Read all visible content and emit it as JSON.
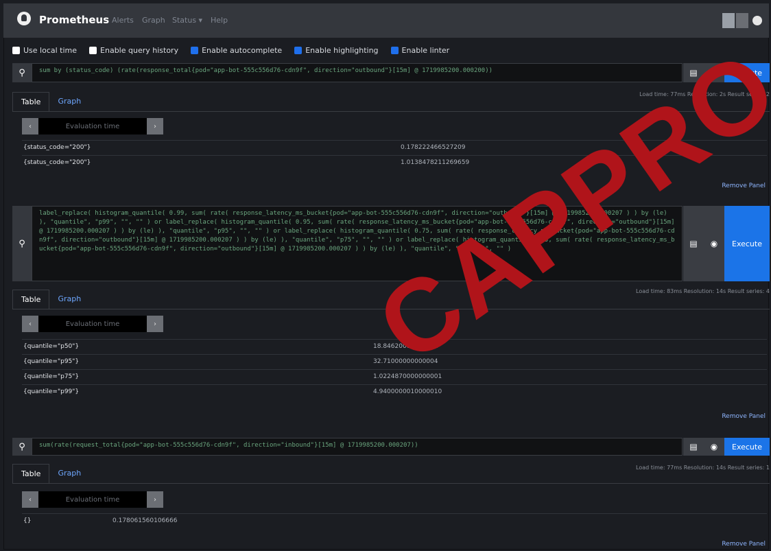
{
  "navbar": {
    "brand": "Prometheus",
    "links": [
      "Alerts",
      "Graph",
      "Status ▾",
      "Help"
    ]
  },
  "options": [
    {
      "label": "Use local time",
      "checked": false
    },
    {
      "label": "Enable query history",
      "checked": false
    },
    {
      "label": "Enable autocomplete",
      "checked": true
    },
    {
      "label": "Enable highlighting",
      "checked": true
    },
    {
      "label": "Enable linter",
      "checked": true
    }
  ],
  "execute_label": "Execute",
  "tab_table": "Table",
  "tab_graph": "Graph",
  "eval_placeholder": "Evaluation time",
  "remove_panel": "Remove Panel",
  "icons": {
    "search": "search-icon",
    "history": "history-icon",
    "metrics": "metrics-explorer-icon",
    "theme": "theme-toggle-icon"
  },
  "panels": [
    {
      "query": "sum by (status_code) (rate(response_total{pod=\"app-bot-555c556d76-cdn9f\", direction=\"outbound\"}[15m] @ 1719985200.000200))",
      "stats": "Load time: 77ms   Resolution: 2s   Result series: 2",
      "rows": [
        {
          "key": "{status_code=\"200\"}",
          "value": "0.178222466527209"
        },
        {
          "key": "{status_code=\"200\"}",
          "value": "1.0138478211269659"
        }
      ]
    },
    {
      "query": "label_replace( histogram_quantile( 0.99, sum( rate( response_latency_ms_bucket{pod=\"app-bot-555c556d76-cdn9f\", direction=\"outbound\"}[15m] @ 1719985200.000207 ) ) by (le) ), \"quantile\", \"p99\", \"\", \"\" ) or label_replace( histogram_quantile( 0.95, sum( rate( response_latency_ms_bucket{pod=\"app-bot-555c556d76-cdn9f\", direction=\"outbound\"}[15m] @ 1719985200.000207 ) ) by (le) ), \"quantile\", \"p95\", \"\", \"\" ) or label_replace( histogram_quantile( 0.75, sum( rate( response_latency_ms_bucket{pod=\"app-bot-555c556d76-cdn9f\", direction=\"outbound\"}[15m] @ 1719985200.000207 ) ) by (le) ), \"quantile\", \"p75\", \"\", \"\" ) or label_replace( histogram_quantile( 0.5, sum( rate( response_latency_ms_bucket{pod=\"app-bot-555c556d76-cdn9f\", direction=\"outbound\"}[15m] @ 1719985200.000207 ) ) by (le) ), \"quantile\", \"p50\", \"\", \"\" )",
      "stats": "Load time: 83ms   Resolution: 14s   Result series: 4",
      "rows": [
        {
          "key": "{quantile=\"p50\"}",
          "value": "18.84620000000001"
        },
        {
          "key": "{quantile=\"p95\"}",
          "value": "32.71000000000004"
        },
        {
          "key": "{quantile=\"p75\"}",
          "value": "1.0224870000000001"
        },
        {
          "key": "{quantile=\"p99\"}",
          "value": "4.9400000010000010"
        }
      ]
    },
    {
      "query": "sum(rate(request_total{pod=\"app-bot-555c556d76-cdn9f\", direction=\"inbound\"}[15m] @ 1719985200.000207))",
      "stats": "Load time: 77ms   Resolution: 14s   Result series: 1",
      "rows": [
        {
          "key": "{}",
          "value": "0.178061560106666"
        }
      ]
    }
  ],
  "watermark": "CAPPRO"
}
